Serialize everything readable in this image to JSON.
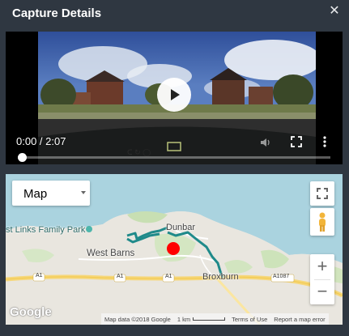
{
  "dialog": {
    "title": "Capture Details",
    "close_symbol": "✕"
  },
  "video": {
    "time": "0:00 / 2:07",
    "progress": 0.0,
    "icons": [
      "play-icon",
      "volume-icon",
      "fullscreen-icon",
      "more-vertical-icon"
    ]
  },
  "map": {
    "type_label": "Map",
    "zoom_in": "+",
    "zoom_out": "−",
    "places": {
      "park": "st Links Family Park",
      "west_barns": "West Barns",
      "dunbar": "Dunbar",
      "broxburn": "Broxburn",
      "road1": "A1",
      "road2": "A1",
      "road3": "A1",
      "road4": "A1087"
    },
    "attribution": {
      "data": "Map data ©2018 Google",
      "scale": "1 km",
      "terms": "Terms of Use",
      "report": "Report a map error"
    },
    "logo": "Google",
    "colors": {
      "route": "#1f8a8a",
      "marker": "#ff0000",
      "sea": "#aad3df"
    },
    "icons": [
      "map-fullscreen-icon",
      "pegman-icon",
      "zoom-in-icon",
      "zoom-out-icon"
    ]
  }
}
